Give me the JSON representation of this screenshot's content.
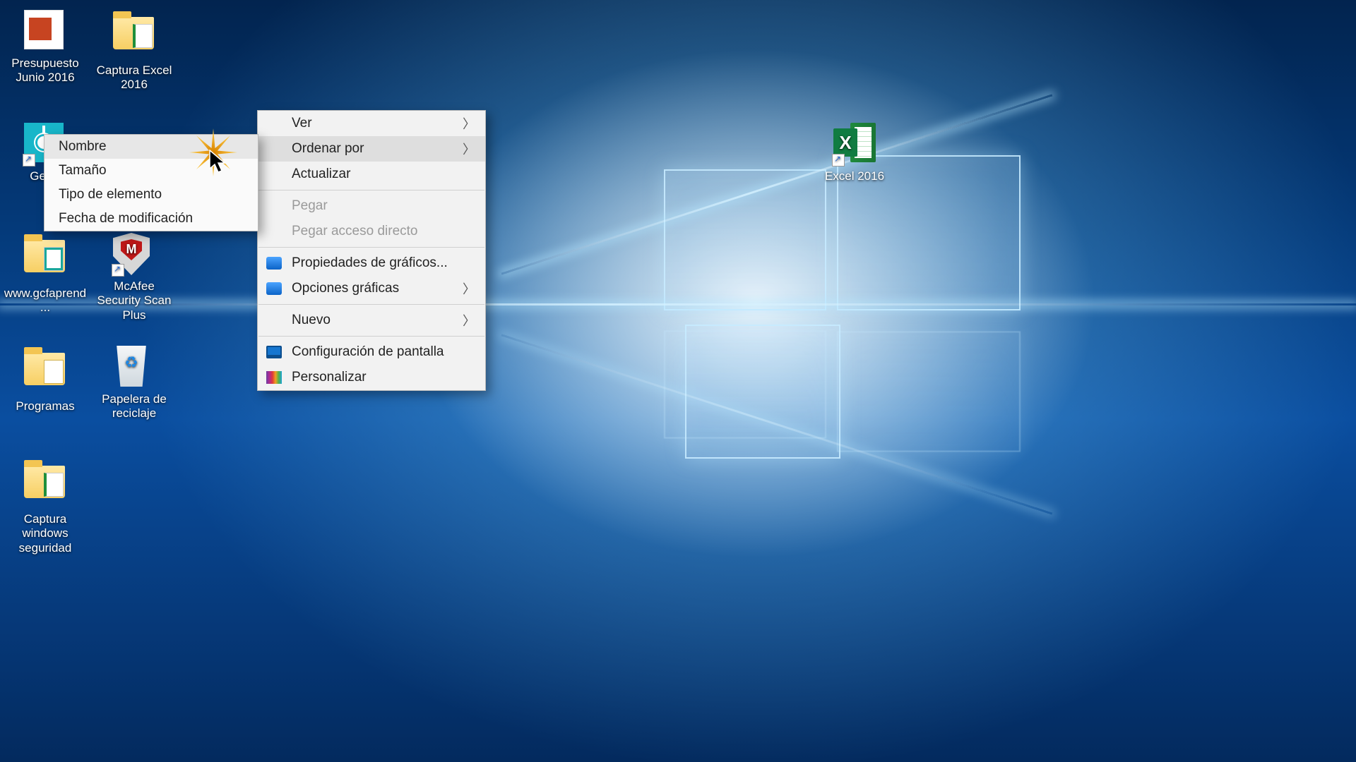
{
  "desktop": {
    "icons": {
      "presupuesto": {
        "label": "Presupuesto Junio 2016"
      },
      "captura_excel": {
        "label": "Captura Excel 2016"
      },
      "get_started": {
        "label": "Get S"
      },
      "gcf": {
        "label": "www.gcfaprend..."
      },
      "mcafee": {
        "label": "McAfee Security Scan Plus"
      },
      "programas": {
        "label": "Programas"
      },
      "recycle": {
        "label": "Papelera de reciclaje"
      },
      "captura_win": {
        "label": "Captura windows seguridad"
      },
      "excel": {
        "label": "Excel 2016"
      }
    }
  },
  "context_menu": {
    "ver": "Ver",
    "ordenar_por": "Ordenar por",
    "actualizar": "Actualizar",
    "pegar": "Pegar",
    "pegar_acceso": "Pegar acceso directo",
    "prop_graficos": "Propiedades de gráficos...",
    "opc_graficas": "Opciones gráficas",
    "nuevo": "Nuevo",
    "config_pantalla": "Configuración de pantalla",
    "personalizar": "Personalizar"
  },
  "sort_submenu": {
    "nombre": "Nombre",
    "tamano": "Tamaño",
    "tipo": "Tipo de elemento",
    "fecha": "Fecha de modificación"
  }
}
